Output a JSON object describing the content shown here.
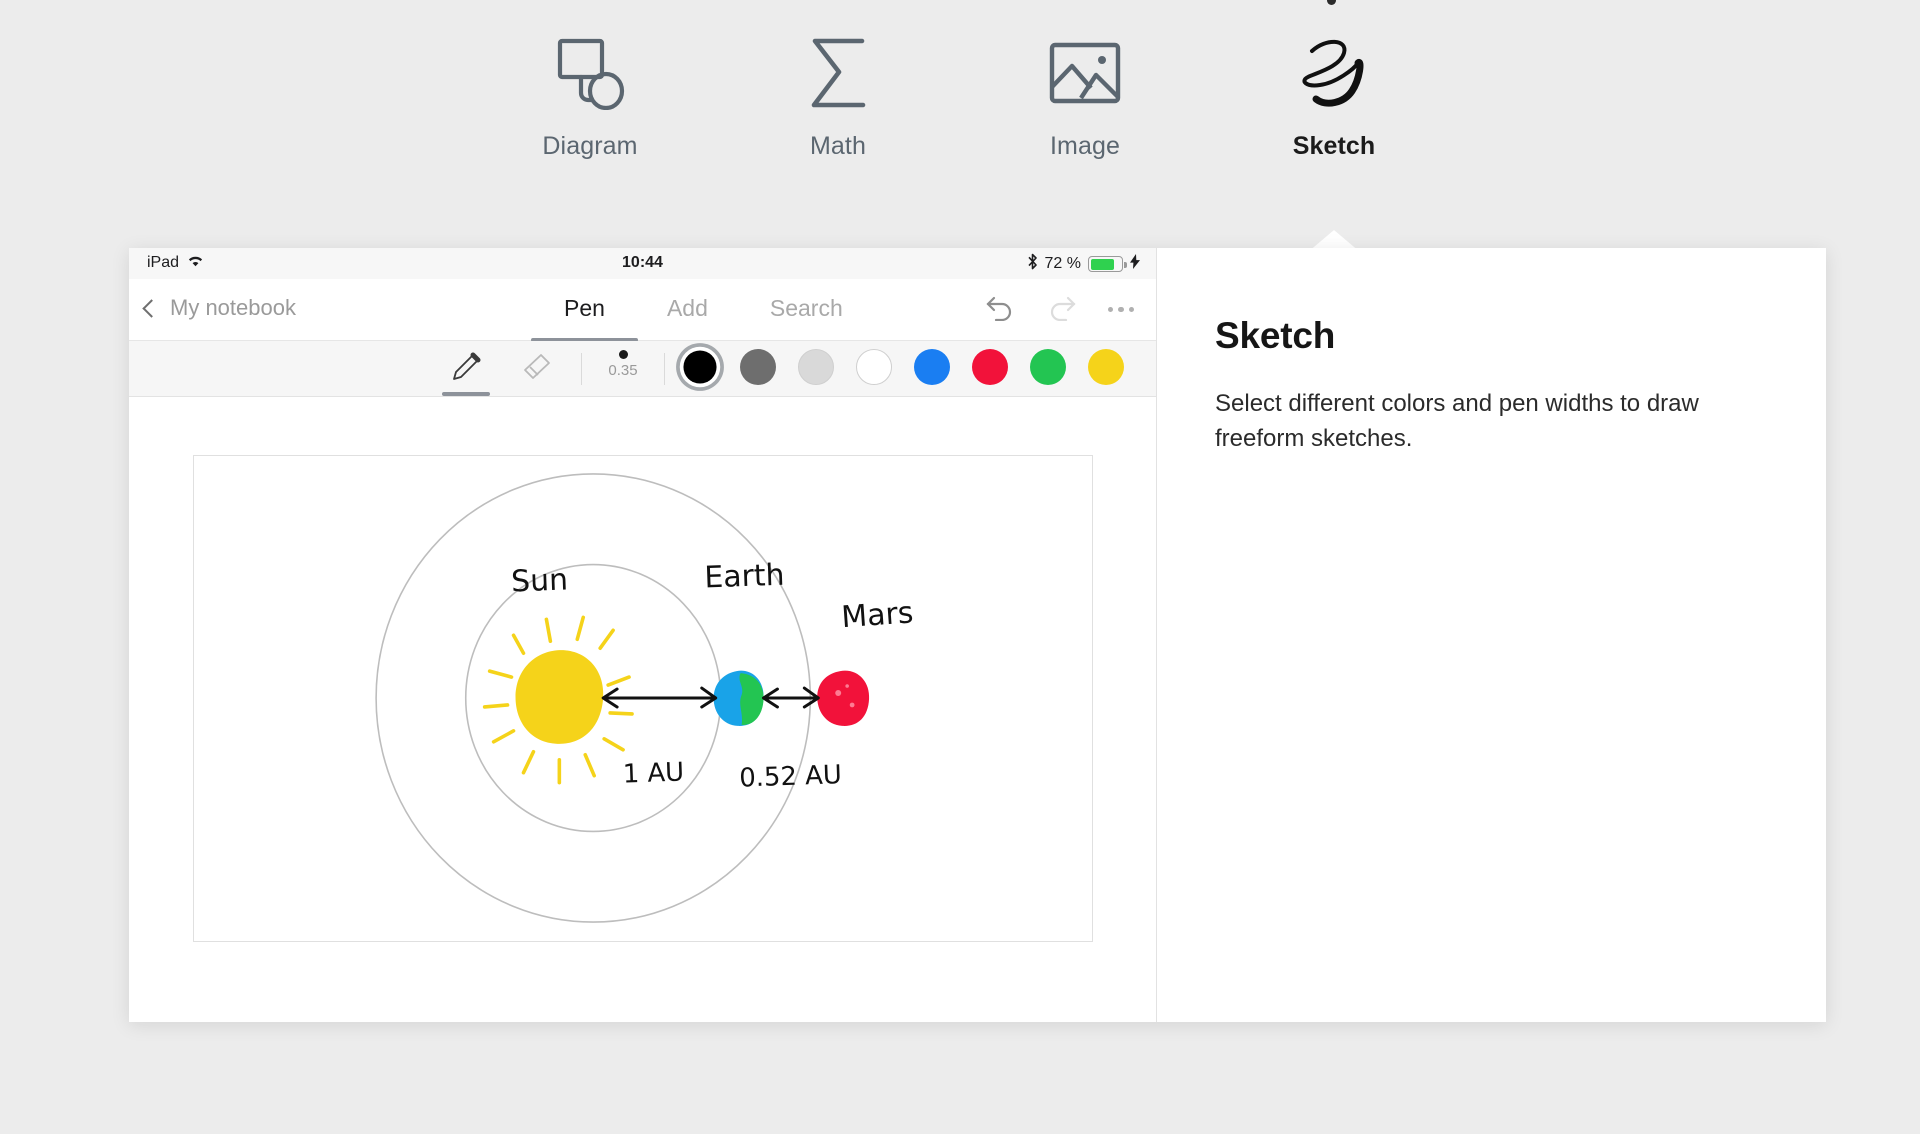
{
  "feature_tabs": [
    {
      "id": "diagram",
      "label": "Diagram",
      "icon": "diagram-shapes-icon",
      "active": false
    },
    {
      "id": "math",
      "label": "Math",
      "icon": "sigma-icon",
      "active": false
    },
    {
      "id": "image",
      "label": "Image",
      "icon": "picture-icon",
      "active": false
    },
    {
      "id": "sketch",
      "label": "Sketch",
      "icon": "scribble-icon",
      "active": true
    }
  ],
  "ipad": {
    "status_bar": {
      "device": "iPad",
      "wifi_icon": "wifi-icon",
      "time": "10:44",
      "bluetooth_icon": "bluetooth-icon",
      "battery_text": "72 %",
      "battery_level": 72,
      "battery_color": "#2fd14f",
      "charging_icon": "lightning-bolt-icon"
    },
    "nav_bar": {
      "back_icon": "chevron-left-icon",
      "back_label": "My notebook",
      "tabs": [
        {
          "label": "Pen",
          "active": true
        },
        {
          "label": "Add",
          "active": false
        },
        {
          "label": "Search",
          "active": false
        }
      ],
      "undo_icon": "undo-arrow-icon",
      "redo_icon": "redo-arrow-icon",
      "more_icon": "more-ellipsis-icon"
    },
    "pen_toolbar": {
      "pen_tool": {
        "icon": "pencil-icon",
        "active": true
      },
      "eraser_tool": {
        "icon": "eraser-icon",
        "active": false
      },
      "pen_width": {
        "value": "0.35",
        "dot_color": "#1a1a1a"
      },
      "colors": [
        {
          "name": "black",
          "hex": "#000000",
          "selected": true
        },
        {
          "name": "gray",
          "hex": "#6e6e6e",
          "selected": false
        },
        {
          "name": "light-gray",
          "hex": "#d9d9d9",
          "selected": false
        },
        {
          "name": "white",
          "hex": "#ffffff",
          "selected": false
        },
        {
          "name": "blue",
          "hex": "#1a7ef2",
          "selected": false
        },
        {
          "name": "red",
          "hex": "#f2123a",
          "selected": false
        },
        {
          "name": "green",
          "hex": "#23c552",
          "selected": false
        },
        {
          "name": "yellow",
          "hex": "#f5d31a",
          "selected": false
        }
      ]
    },
    "sketch_canvas": {
      "labels": {
        "sun": "Sun",
        "earth": "Earth",
        "mars": "Mars",
        "distance_sun_earth": "1 AU",
        "distance_earth_mars": "0.52 AU"
      },
      "colors": {
        "sun": "#f5d31a",
        "earth_ocean": "#19a3e8",
        "earth_land": "#23c552",
        "mars": "#f2123a",
        "orbit": "#bdbdbd",
        "ink": "#111111"
      }
    }
  },
  "info_panel": {
    "title": "Sketch",
    "description": "Select different colors and pen widths to draw freeform sketches."
  }
}
